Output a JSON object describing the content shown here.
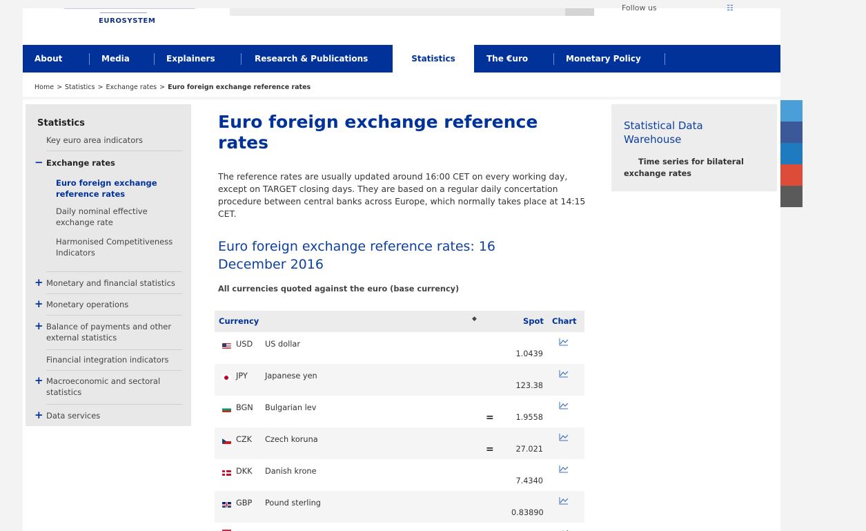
{
  "header": {
    "logo_text": "EUROSYSTEM",
    "follow_label": "Follow us"
  },
  "nav": {
    "items": [
      {
        "label": "About"
      },
      {
        "label": "Media"
      },
      {
        "label": "Explainers"
      },
      {
        "label": "Research & Publications"
      },
      {
        "label": "Statistics"
      },
      {
        "label": "The €uro"
      },
      {
        "label": "Monetary Policy"
      }
    ],
    "active_index": 4
  },
  "breadcrumb": {
    "items": [
      "Home",
      "Statistics",
      "Exchange rates"
    ],
    "current": "Euro foreign exchange reference rates",
    "separator": ">"
  },
  "sidebar": {
    "title": "Statistics",
    "items": [
      {
        "label": "Key euro area indicators"
      },
      {
        "label": "Exchange rates",
        "sign": "−"
      },
      {
        "label": "Euro foreign exchange reference rates"
      },
      {
        "label": "Daily nominal effective exchange rate"
      },
      {
        "label": "Harmonised Competitiveness Indicators"
      },
      {
        "label": "Monetary and financial statistics",
        "sign": "+"
      },
      {
        "label": "Monetary operations",
        "sign": "+"
      },
      {
        "label": "Balance of payments and other external statistics",
        "sign": "+"
      },
      {
        "label": "Financial integration indicators"
      },
      {
        "label": "Macroeconomic and sectoral statistics",
        "sign": "+"
      },
      {
        "label": "Data services",
        "sign": "+"
      }
    ]
  },
  "main": {
    "title": "Euro foreign exchange reference rates",
    "intro": "The reference rates are usually updated around 16:00 CET on every working day, except on TARGET closing days. They are based on a regular daily concertation procedure between central banks across Europe, which normally takes place at 14:15 CET.",
    "subtitle": "Euro foreign exchange reference rates: 16 December 2016",
    "quoted_note": "All currencies quoted against the euro (base currency)"
  },
  "table": {
    "headers": {
      "currency": "Currency",
      "sort": "◆",
      "spot": "Spot",
      "chart": "Chart"
    },
    "rows": [
      {
        "code": "USD",
        "name": "US dollar",
        "spot": "1.0439",
        "unchanged": ""
      },
      {
        "code": "JPY",
        "name": "Japanese yen",
        "spot": "123.38",
        "unchanged": ""
      },
      {
        "code": "BGN",
        "name": "Bulgarian lev",
        "spot": "1.9558",
        "unchanged": "="
      },
      {
        "code": "CZK",
        "name": "Czech koruna",
        "spot": "27.021",
        "unchanged": "="
      },
      {
        "code": "DKK",
        "name": "Danish krone",
        "spot": "7.4340",
        "unchanged": ""
      },
      {
        "code": "GBP",
        "name": "Pound sterling",
        "spot": "0.83890",
        "unchanged": ""
      }
    ]
  },
  "sdw": {
    "title": "Statistical Data Warehouse",
    "link": "Time series for bilateral exchange rates"
  },
  "colors": {
    "brand_blue": "#003299",
    "share_colors": [
      "#4a9fd8",
      "#3b5998",
      "#1e7bbf",
      "#dd4b39",
      "#5a5a5a"
    ]
  }
}
